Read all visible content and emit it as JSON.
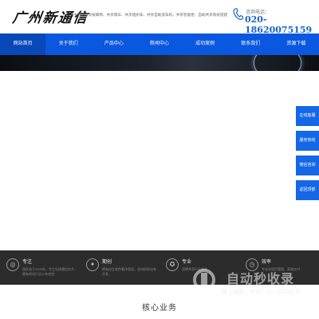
{
  "header": {
    "logo_text": "广州新通信",
    "business": "公司主营：共享按摩椅、共享雨伞、共享陪护床、共享自助洗车机、共享智能柜、自助共享系统搭建",
    "phone_label": "咨询电话：",
    "phone_number": "020-18620075159",
    "icon": "phone-icon"
  },
  "nav": {
    "items": [
      "网站首页",
      "关于我们",
      "产品中心",
      "新闻中心",
      "成功案例",
      "联系我们",
      "资源下载"
    ],
    "active_index": 0,
    "color": "#0a57e0"
  },
  "side": {
    "items": [
      "在线客服",
      "服务热线",
      "微信咨询",
      "返回顶部"
    ],
    "color": "#1467e6"
  },
  "features": [
    {
      "icon": "target-icon",
      "title": "专注",
      "desc": "团队始于2009年，专注无线通信技术，拥有网站行业10年经验"
    },
    {
      "icon": "bulb-icon",
      "title": "期创",
      "desc": "拥有自主软件著作版权，坚持研发自有开发。"
    },
    {
      "icon": "medal-icon",
      "title": "专业",
      "desc": "深耕共享行业多年"
    },
    {
      "icon": "clock-icon",
      "title": "效率",
      "desc": "专业化项目管理，高效交付"
    }
  ],
  "section": {
    "title": "核心业务"
  },
  "watermark": {
    "title": "自动秒收录",
    "sub": "做上链接→来访一次→自动收录"
  }
}
